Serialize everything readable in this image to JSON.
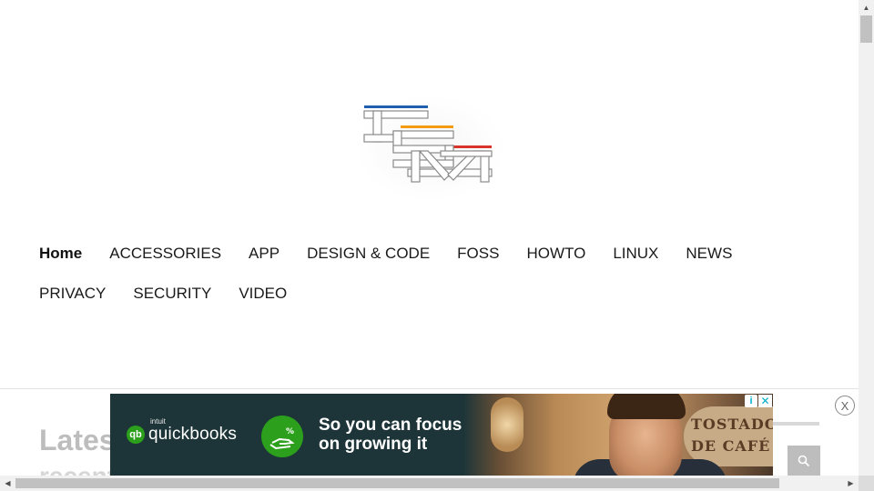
{
  "site": {
    "logo_text": "FSM",
    "logo_colors": {
      "top_bar": "#1f5fae",
      "middle_bar": "#f39c12",
      "bottom_bar": "#d9342b"
    }
  },
  "nav": {
    "row1": [
      {
        "label": "Home",
        "active": true
      },
      {
        "label": "ACCESSORIES"
      },
      {
        "label": "APP"
      },
      {
        "label": "DESIGN & CODE"
      },
      {
        "label": "FOSS"
      },
      {
        "label": "HOWTO"
      },
      {
        "label": "LINUX"
      },
      {
        "label": "NEWS"
      }
    ],
    "row2": [
      {
        "label": "PRIVACY"
      },
      {
        "label": "SECURITY"
      },
      {
        "label": "VIDEO"
      }
    ]
  },
  "content": {
    "latest_title": "Latest",
    "latest_sub": "recent"
  },
  "ad": {
    "brand_prefix": "intuit",
    "brand": "quickbooks",
    "brand_icon": "qb",
    "headline_line1": "So you can focus",
    "headline_line2": "on growing it",
    "photo_sign": "TOSTADO DE CAFÉ",
    "info_glyph": "i",
    "close_glyph": "✕",
    "brand_color": "#2ca01c",
    "background_color": "#1d3538"
  },
  "anchor": {
    "close_label": "X"
  },
  "icons": {
    "search": "search-icon",
    "scroll_up": "▲",
    "scroll_left": "◀",
    "scroll_right": "▶"
  }
}
